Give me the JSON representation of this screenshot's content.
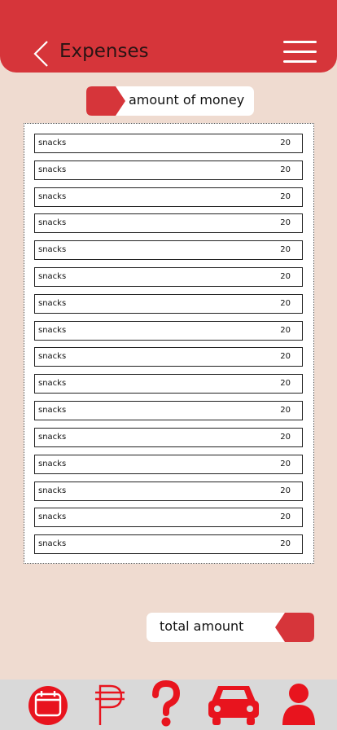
{
  "header": {
    "title": "Expenses",
    "back_icon": "chevron-left-icon",
    "menu_icon": "hamburger-menu-icon"
  },
  "amount_header": {
    "label": "amount of money"
  },
  "expenses": [
    {
      "name": "snacks",
      "amount": "20"
    },
    {
      "name": "snacks",
      "amount": "20"
    },
    {
      "name": "snacks",
      "amount": "20"
    },
    {
      "name": "snacks",
      "amount": "20"
    },
    {
      "name": "snacks",
      "amount": "20"
    },
    {
      "name": "snacks",
      "amount": "20"
    },
    {
      "name": "snacks",
      "amount": "20"
    },
    {
      "name": "snacks",
      "amount": "20"
    },
    {
      "name": "snacks",
      "amount": "20"
    },
    {
      "name": "snacks",
      "amount": "20"
    },
    {
      "name": "snacks",
      "amount": "20"
    },
    {
      "name": "snacks",
      "amount": "20"
    },
    {
      "name": "snacks",
      "amount": "20"
    },
    {
      "name": "snacks",
      "amount": "20"
    },
    {
      "name": "snacks",
      "amount": "20"
    },
    {
      "name": "snacks",
      "amount": "20"
    }
  ],
  "total": {
    "label": "total amount"
  },
  "bottom_nav": [
    {
      "icon": "calendar-icon"
    },
    {
      "icon": "peso-icon"
    },
    {
      "icon": "question-mark-icon"
    },
    {
      "icon": "car-icon"
    },
    {
      "icon": "user-icon"
    }
  ],
  "colors": {
    "accent": "#d6353a",
    "background": "#efdbd0",
    "nav_background": "#d9d9d9"
  }
}
